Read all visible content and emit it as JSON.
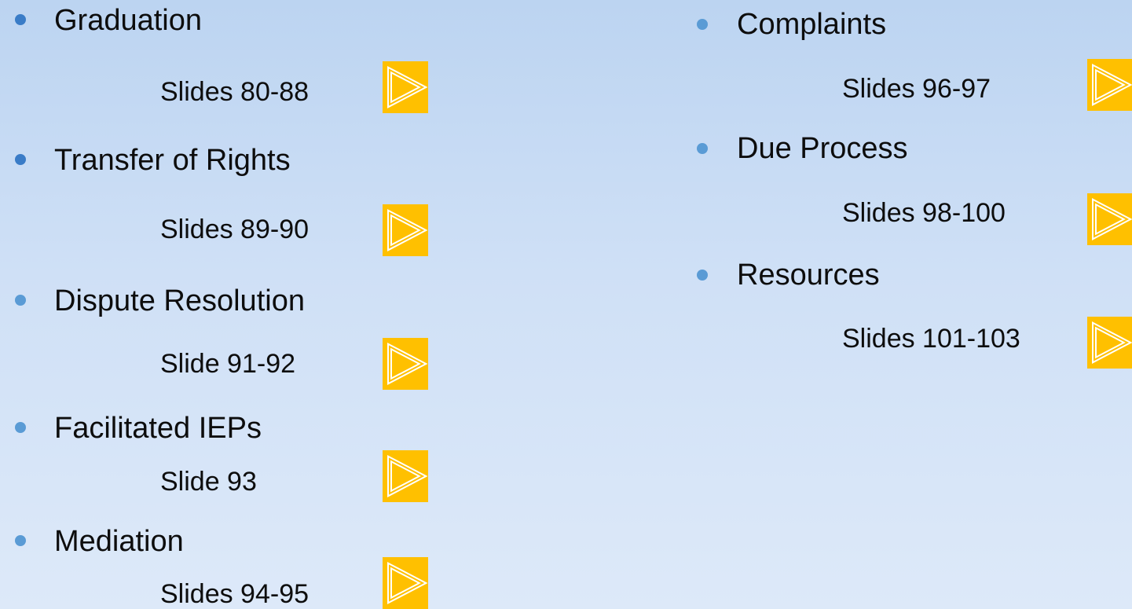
{
  "left_column": [
    {
      "title": "Graduation",
      "slides": "Slides 80-88",
      "button_icon": "play-arrow-icon"
    },
    {
      "title": "Transfer of Rights",
      "slides": "Slides 89-90",
      "button_icon": "play-arrow-icon"
    },
    {
      "title": "Dispute Resolution",
      "slides": "Slide 91-92",
      "button_icon": "play-arrow-icon"
    },
    {
      "title": "Facilitated IEPs",
      "slides": "Slide 93",
      "button_icon": "play-arrow-icon"
    },
    {
      "title": "Mediation",
      "slides": "Slides 94-95",
      "button_icon": "play-arrow-icon"
    }
  ],
  "right_column": [
    {
      "title": "Complaints",
      "slides": "Slides 96-97",
      "button_icon": "play-arrow-icon"
    },
    {
      "title": "Due Process",
      "slides": "Slides 98-100",
      "button_icon": "play-arrow-icon"
    },
    {
      "title": "Resources",
      "slides": "Slides 101-103",
      "button_icon": "play-arrow-icon"
    }
  ],
  "colors": {
    "accent": "#ffc000",
    "bullet": "#5a9bd5",
    "text": "#0d0d0d"
  }
}
